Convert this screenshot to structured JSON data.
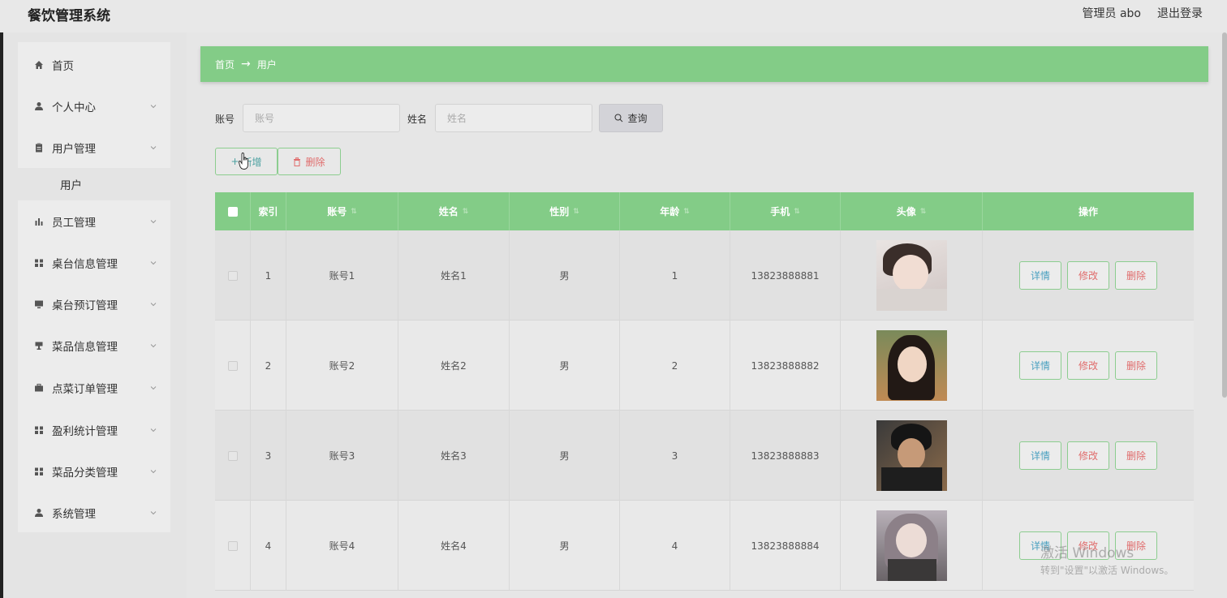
{
  "app": {
    "title": "餐饮管理系统"
  },
  "header": {
    "user": "管理员 abo",
    "logout": "退出登录"
  },
  "sidebar": {
    "items": [
      {
        "label": "首页",
        "icon": "home-icon",
        "has_children": false
      },
      {
        "label": "个人中心",
        "icon": "user-icon",
        "has_children": true
      },
      {
        "label": "用户管理",
        "icon": "clipboard-icon",
        "has_children": true
      },
      {
        "label": "员工管理",
        "icon": "bar-chart-icon",
        "has_children": true
      },
      {
        "label": "桌台信息管理",
        "icon": "grid-icon",
        "has_children": true
      },
      {
        "label": "桌台预订管理",
        "icon": "monitor-icon",
        "has_children": true
      },
      {
        "label": "菜品信息管理",
        "icon": "cup-icon",
        "has_children": true
      },
      {
        "label": "点菜订单管理",
        "icon": "briefcase-icon",
        "has_children": true
      },
      {
        "label": "盈利统计管理",
        "icon": "grid-icon",
        "has_children": true
      },
      {
        "label": "菜品分类管理",
        "icon": "grid-icon",
        "has_children": true
      },
      {
        "label": "系统管理",
        "icon": "user-icon",
        "has_children": true
      }
    ],
    "subitem": "用户"
  },
  "breadcrumb": {
    "home": "首页",
    "arrow": "→",
    "current": "用户"
  },
  "search": {
    "account_label": "账号",
    "account_placeholder": "账号",
    "name_label": "姓名",
    "name_placeholder": "姓名",
    "query_button": "查询"
  },
  "actions": {
    "add": "新增",
    "delete": "删除"
  },
  "table": {
    "headers": [
      "索引",
      "账号",
      "姓名",
      "性别",
      "年龄",
      "手机",
      "头像",
      "操作"
    ],
    "rows": [
      {
        "index": "1",
        "account": "账号1",
        "name": "姓名1",
        "gender": "男",
        "age": "1",
        "phone": "13823888881"
      },
      {
        "index": "2",
        "account": "账号2",
        "name": "姓名2",
        "gender": "男",
        "age": "2",
        "phone": "13823888882"
      },
      {
        "index": "3",
        "account": "账号3",
        "name": "姓名3",
        "gender": "男",
        "age": "3",
        "phone": "13823888883"
      },
      {
        "index": "4",
        "account": "账号4",
        "name": "姓名4",
        "gender": "男",
        "age": "4",
        "phone": "13823888884"
      }
    ],
    "row_ops": {
      "detail": "详情",
      "edit": "修改",
      "remove": "删除"
    }
  },
  "watermark": {
    "line1": "激活 Windows",
    "line2": "转到\"设置\"以激活 Windows。"
  },
  "colors": {
    "accent": "#83cc87",
    "danger": "#e06c6c",
    "info": "#4aa0c0"
  }
}
